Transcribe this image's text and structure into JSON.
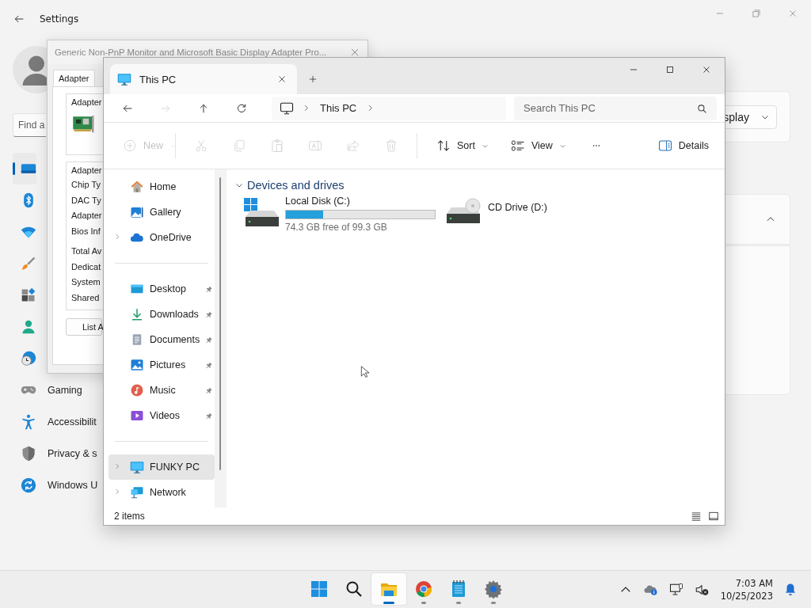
{
  "settings": {
    "title": "Settings",
    "search": {
      "placeholder": "Find a"
    },
    "nav": [
      {
        "selected": true
      },
      {
        "selected": false
      },
      {
        "selected": false
      },
      {
        "selected": false
      },
      {
        "selected": false
      },
      {
        "selected": false
      },
      {
        "selected": false
      },
      {
        "label": "Gaming",
        "selected": false
      },
      {
        "label": "Accessibilit",
        "selected": false
      },
      {
        "label": "Privacy & s",
        "selected": false
      },
      {
        "label": "Windows U",
        "selected": false
      }
    ],
    "cards": [
      {
        "kind": "dropdown",
        "value": "splay"
      },
      {
        "kind": "expander",
        "expanded": true
      },
      {
        "kind": "panel"
      }
    ]
  },
  "dialog": {
    "title": "Generic Non-PnP Monitor and Microsoft Basic Display Adapter Pro...",
    "tabs": [
      {
        "label": "Adapter",
        "selected": true
      }
    ],
    "picture_group": {
      "label": "Adapter"
    },
    "info_group": {
      "label": "Adapter",
      "rows": [
        "Chip Ty",
        "DAC Ty",
        "Adapter",
        "Bios Inf"
      ],
      "memory_rows": [
        "Total Av",
        "Dedicat",
        "System",
        "Shared"
      ]
    },
    "button": "List A"
  },
  "explorer": {
    "tabs": [
      {
        "label": "This PC",
        "selected": true
      }
    ],
    "nav_buttons": [
      {
        "kind": "back",
        "disabled": false
      },
      {
        "kind": "forward",
        "disabled": true
      },
      {
        "kind": "up",
        "disabled": false
      },
      {
        "kind": "refresh",
        "disabled": false
      }
    ],
    "address": {
      "path": [
        "This PC"
      ]
    },
    "search": {
      "placeholder": "Search This PC"
    },
    "commands": [
      {
        "kind": "new",
        "label": "New",
        "disabled": true
      },
      {
        "kind": "cut",
        "disabled": true
      },
      {
        "kind": "copy",
        "disabled": true
      },
      {
        "kind": "paste",
        "disabled": true
      },
      {
        "kind": "rename",
        "disabled": true
      },
      {
        "kind": "share",
        "disabled": true
      },
      {
        "kind": "delete",
        "disabled": true
      },
      {
        "kind": "sort",
        "label": "Sort",
        "disabled": false
      },
      {
        "kind": "view",
        "label": "View",
        "disabled": false
      },
      {
        "kind": "more",
        "disabled": false
      },
      {
        "kind": "details",
        "label": "Details",
        "disabled": false
      }
    ],
    "nav_pane": [
      [
        {
          "label": "Home",
          "expandable": false,
          "pinned": false,
          "selected": false
        },
        {
          "label": "Gallery",
          "expandable": false,
          "pinned": false,
          "selected": false
        },
        {
          "label": "OneDrive",
          "expandable": true,
          "pinned": false,
          "selected": false
        }
      ],
      [
        {
          "label": "Desktop",
          "expandable": false,
          "pinned": true,
          "selected": false
        },
        {
          "label": "Downloads",
          "expandable": false,
          "pinned": true,
          "selected": false
        },
        {
          "label": "Documents",
          "expandable": false,
          "pinned": true,
          "selected": false
        },
        {
          "label": "Pictures",
          "expandable": false,
          "pinned": true,
          "selected": false
        },
        {
          "label": "Music",
          "expandable": false,
          "pinned": true,
          "selected": false
        },
        {
          "label": "Videos",
          "expandable": false,
          "pinned": true,
          "selected": false
        }
      ],
      [
        {
          "label": "FUNKY PC",
          "expandable": true,
          "pinned": false,
          "selected": true
        },
        {
          "label": "Network",
          "expandable": true,
          "pinned": false,
          "selected": false
        }
      ]
    ],
    "group": {
      "label": "Devices and drives",
      "expanded": true
    },
    "drives": [
      {
        "kind": "disk",
        "label": "Local Disk (C:)",
        "level": 0.25,
        "free": "74.3 GB free of 99.3 GB"
      },
      {
        "kind": "cd",
        "label": "CD Drive (D:)"
      }
    ],
    "status": "2 items",
    "views": [
      {
        "kind": "details"
      },
      {
        "kind": "tiles"
      }
    ]
  },
  "taskbar": {
    "apps": [
      {
        "running": false,
        "active": false
      },
      {
        "running": false,
        "active": false
      },
      {
        "running": true,
        "active": true
      },
      {
        "running": true,
        "active": false
      },
      {
        "running": true,
        "active": false
      },
      {
        "running": true,
        "active": false
      }
    ],
    "clock": {
      "time": "7:03 AM",
      "date": "10/25/2023"
    }
  }
}
